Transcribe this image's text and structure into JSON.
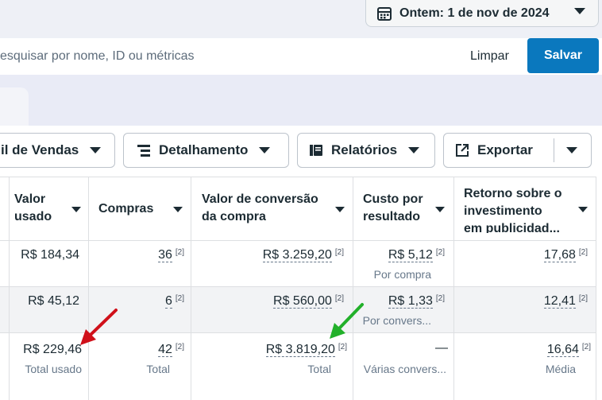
{
  "header": {
    "date_label": "Ontem: 1 de nov de 2024"
  },
  "search": {
    "placeholder": "esquisar por nome, ID ou métricas",
    "clear_label": "Limpar",
    "save_label": "Salvar"
  },
  "toolbar": {
    "funnel_label": "il de Vendas",
    "breakdown_label": "Detalhamento",
    "reports_label": "Relatórios",
    "export_label": "Exportar"
  },
  "table": {
    "columns": [
      {
        "line1": "Valor",
        "line2": "usado"
      },
      {
        "line1": "Compras",
        "line2": ""
      },
      {
        "line1": "Valor de conversão",
        "line2": "da compra"
      },
      {
        "line1": "Custo por",
        "line2": "resultado"
      },
      {
        "line1": "Retorno sobre o",
        "line2": "investimento",
        "line3": "em publicidad..."
      }
    ],
    "rows": [
      {
        "spent": "R$ 184,34",
        "purchases": "36",
        "purchases_sup": "[2]",
        "conv_value": "R$ 3.259,20",
        "conv_sup": "[2]",
        "cost": "R$ 5,12",
        "cost_sup": "[2]",
        "cost_sub": "Por compra",
        "roas": "17,68",
        "roas_sup": "[2]"
      },
      {
        "spent": "R$ 45,12",
        "purchases": "6",
        "purchases_sup": "[2]",
        "conv_value": "R$ 560,00",
        "conv_sup": "[2]",
        "cost": "R$ 1,33",
        "cost_sup": "[2]",
        "cost_sub": "Por convers...",
        "roas": "12,41",
        "roas_sup": "[2]"
      }
    ],
    "totals": {
      "spent": "R$ 229,46",
      "spent_sub": "Total usado",
      "purchases": "42",
      "purchases_sup": "[2]",
      "purchases_sub": "Total",
      "conv_value": "R$ 3.819,20",
      "conv_sup": "[2]",
      "conv_sub": "Total",
      "cost": "—",
      "cost_sub": "Várias convers...",
      "roas": "16,64",
      "roas_sup": "[2]",
      "roas_sub": "Média"
    }
  },
  "annotations": {
    "red_arrow_color": "#d0101a",
    "green_arrow_color": "#22b02a"
  }
}
